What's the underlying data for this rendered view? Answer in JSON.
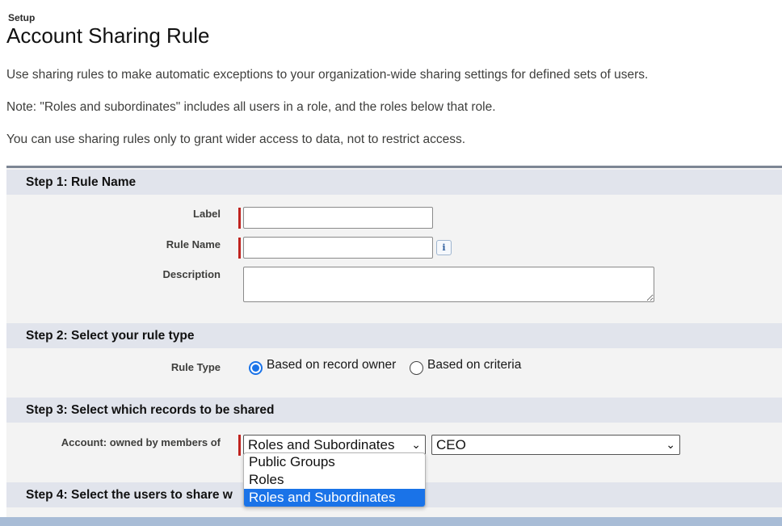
{
  "header": {
    "breadcrumb": "Setup",
    "title": "Account Sharing Rule"
  },
  "intro": {
    "line1": "Use sharing rules to make automatic exceptions to your organization-wide sharing settings for defined sets of users.",
    "line2": "Note: \"Roles and subordinates\" includes all users in a role, and the roles below that role.",
    "line3": "You can use sharing rules only to grant wider access to data, not to restrict access."
  },
  "step1": {
    "header": "Step 1: Rule Name",
    "label_label": "Label",
    "label_value": "",
    "rule_name_label": "Rule Name",
    "rule_name_value": "",
    "info_icon": "i",
    "description_label": "Description",
    "description_value": ""
  },
  "step2": {
    "header": "Step 2: Select your rule type",
    "rule_type_label": "Rule Type",
    "option_owner": "Based on record owner",
    "option_criteria": "Based on criteria",
    "selected": "Based on record owner"
  },
  "step3": {
    "header": "Step 3: Select which records to be shared",
    "owned_by_label": "Account: owned by members of",
    "owner_type_value": "Roles and Subordinates",
    "owner_value": "CEO",
    "dropdown_options": [
      "Public Groups",
      "Roles",
      "Roles and Subordinates"
    ]
  },
  "step4": {
    "header": "Step 4: Select the users to share w"
  },
  "colors": {
    "required": "#c0231f",
    "accent": "#1a73e8",
    "step_header_bg": "#e1e4ec",
    "panel_bg": "#f3f3f3"
  }
}
